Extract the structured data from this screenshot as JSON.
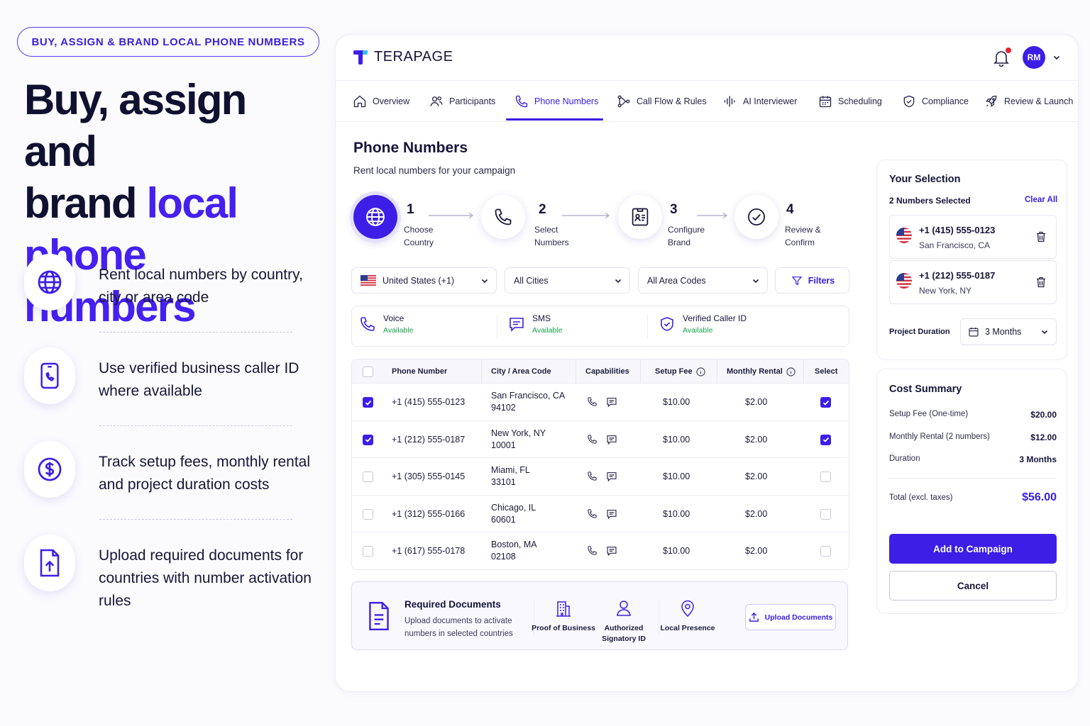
{
  "promo": {
    "pill": "BUY, ASSIGN & BRAND LOCAL PHONE NUMBERS",
    "hero_line1": "Buy, assign and",
    "hero_line2a": "brand ",
    "hero_line2b": "local",
    "hero_line3": "phone numbers",
    "features": [
      {
        "text": "Rent local numbers by country, city or area code",
        "icon": "globe-icon"
      },
      {
        "text": "Use verified business caller ID where available",
        "icon": "phone-badge-icon"
      },
      {
        "text": "Track setup fees, monthly rental and project duration costs",
        "icon": "dollar-icon"
      },
      {
        "text": "Upload required documents for countries with number activation rules",
        "icon": "upload-doc-icon"
      }
    ]
  },
  "app": {
    "brand": "TERAPAGE",
    "avatar": "RM",
    "colors": {
      "accent": "#3d1ee6",
      "success": "#16a04a",
      "alert": "#e7232e"
    },
    "tabs": [
      {
        "label": "Overview",
        "icon": "home-icon"
      },
      {
        "label": "Participants",
        "icon": "users-icon"
      },
      {
        "label": "Phone Numbers",
        "icon": "phone-icon",
        "active": true
      },
      {
        "label": "Call Flow & Rules",
        "icon": "flow-icon"
      },
      {
        "label": "AI Interviewer",
        "icon": "waveform-icon"
      },
      {
        "label": "Scheduling",
        "icon": "calendar-icon"
      },
      {
        "label": "Compliance",
        "icon": "shield-icon"
      },
      {
        "label": "Review & Launch",
        "icon": "rocket-icon"
      }
    ],
    "page_title": "Phone Numbers",
    "page_subtitle": "Rent local numbers for your campaign",
    "steps": [
      {
        "num": "1",
        "label": "Choose Country",
        "icon": "globe-icon",
        "active": true
      },
      {
        "num": "2",
        "label": "Select Numbers",
        "icon": "phone-icon"
      },
      {
        "num": "3",
        "label": "Configure Brand",
        "icon": "id-card-icon"
      },
      {
        "num": "4",
        "label": "Review & Confirm",
        "icon": "check-circle-icon"
      }
    ],
    "filters": {
      "country": "United States (+1)",
      "city": "All Cities",
      "area_code": "All Area Codes",
      "filters_label": "Filters"
    },
    "capabilities": [
      {
        "title": "Voice",
        "status": "Available",
        "icon": "phone-icon"
      },
      {
        "title": "SMS",
        "status": "Available",
        "icon": "sms-icon"
      },
      {
        "title": "Verified Caller ID",
        "status": "Available",
        "icon": "shield-check-icon"
      }
    ],
    "table": {
      "headers": [
        "Phone Number",
        "City / Area Code",
        "Capabilities",
        "Setup Fee",
        "Monthly Rental",
        "Select"
      ],
      "rows": [
        {
          "number": "+1 (415) 555-0123",
          "city": "San Francisco, CA",
          "zip": "94102",
          "setup": "$10.00",
          "monthly": "$2.00",
          "checked": true
        },
        {
          "number": "+1 (212) 555-0187",
          "city": "New York, NY",
          "zip": "10001",
          "setup": "$10.00",
          "monthly": "$2.00",
          "checked": true
        },
        {
          "number": "+1 (305) 555-0145",
          "city": "Miami, FL",
          "zip": "33101",
          "setup": "$10.00",
          "monthly": "$2.00",
          "checked": false
        },
        {
          "number": "+1 (312) 555-0166",
          "city": "Chicago, IL",
          "zip": "60601",
          "setup": "$10.00",
          "monthly": "$2.00",
          "checked": false
        },
        {
          "number": "+1 (617) 555-0178",
          "city": "Boston, MA",
          "zip": "02108",
          "setup": "$10.00",
          "monthly": "$2.00",
          "checked": false
        }
      ]
    },
    "documents": {
      "title": "Required Documents",
      "subtitle": "Upload documents to activate numbers in selected countries",
      "items": [
        {
          "label": "Proof of Business",
          "icon": "building-icon"
        },
        {
          "label": "Authorized Signatory ID",
          "icon": "user-icon"
        },
        {
          "label": "Local Presence",
          "icon": "location-pin-icon"
        }
      ],
      "upload_label": "Upload Documents"
    },
    "selection": {
      "title": "Your Selection",
      "count": "2 Numbers Selected",
      "clear_all": "Clear All",
      "items": [
        {
          "number": "+1 (415) 555-0123",
          "city": "San Francisco, CA"
        },
        {
          "number": "+1 (212) 555-0187",
          "city": "New York, NY"
        }
      ],
      "duration_label": "Project Duration",
      "duration_value": "3 Months"
    },
    "cost": {
      "title": "Cost Summary",
      "rows": [
        {
          "label": "Setup Fee (One-time)",
          "value": "$20.00"
        },
        {
          "label": "Monthly Rental (2 numbers)",
          "value": "$12.00"
        },
        {
          "label": "Duration",
          "value": "3 Months"
        }
      ],
      "total_label": "Total (excl. taxes)",
      "total_value": "$56.00",
      "add_button": "Add to Campaign",
      "cancel_button": "Cancel"
    }
  }
}
